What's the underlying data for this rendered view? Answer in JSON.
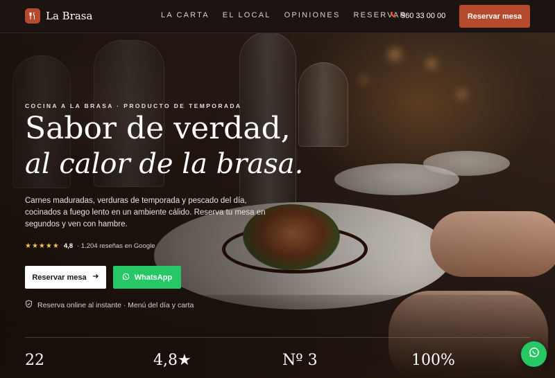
{
  "brand": {
    "name": "La Brasa",
    "logo_icon": "fork-knife-icon",
    "accent": "#b54a2c"
  },
  "nav": {
    "items": [
      "LA CARTA",
      "EL LOCAL",
      "OPINIONES",
      "RESERVAR"
    ]
  },
  "phone": {
    "icon": "phone-icon",
    "number": "960 33 00 00"
  },
  "header_cta": {
    "label": "Reservar mesa"
  },
  "hero": {
    "kicker": "COCINA A LA BRASA · PRODUCTO DE TEMPORADA",
    "title_line1": "Sabor de verdad,",
    "title_line2": "al calor de la brasa.",
    "description": "Carnes maduradas, verduras de temporada y pescado del día, cocinados a fuego lento en un ambiente cálido. Reserva tu mesa en segundos y ven con hambre.",
    "rating": {
      "stars": "★★★★★",
      "value": "4,8",
      "reviews": "· 1.204 reseñas en Google",
      "star_color": "#f3c04a"
    },
    "primary_button": {
      "label": "Reservar mesa",
      "icon": "arrow-right-icon"
    },
    "whatsapp_button": {
      "label": "WhatsApp",
      "icon": "whatsapp-icon",
      "color": "#25c864"
    },
    "assurance": {
      "icon": "shield-check-icon",
      "text": "Reserva online al instante · Menú del día y carta"
    }
  },
  "stats": [
    "22",
    "4,8★",
    "Nº 3",
    "100%"
  ],
  "floating_whatsapp": {
    "icon": "whatsapp-icon"
  }
}
